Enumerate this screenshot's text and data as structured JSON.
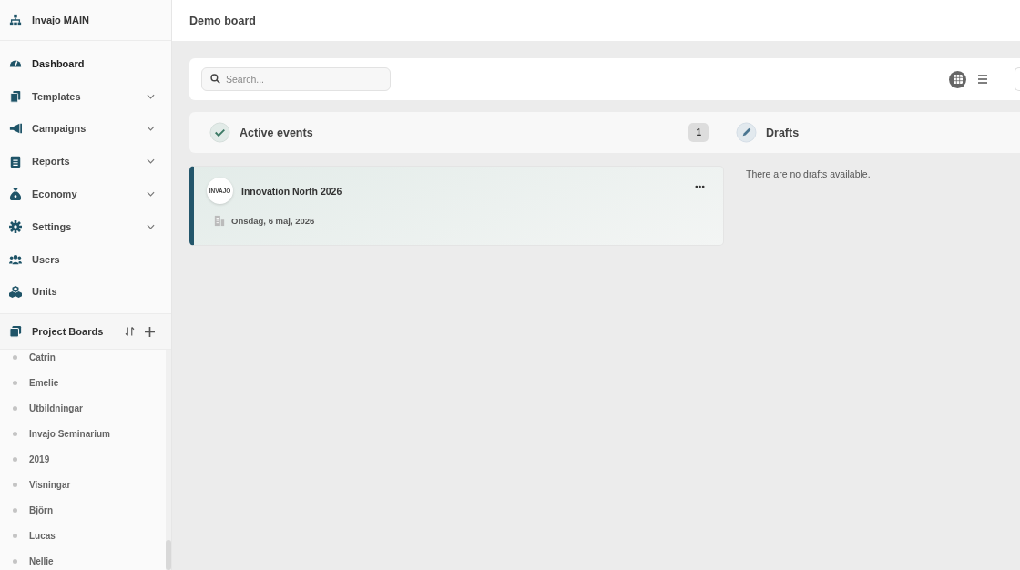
{
  "sidebar": {
    "brand": "Invajo MAIN",
    "nav": [
      {
        "label": "Dashboard",
        "expandable": false
      },
      {
        "label": "Templates",
        "expandable": true
      },
      {
        "label": "Campaigns",
        "expandable": true
      },
      {
        "label": "Reports",
        "expandable": true
      },
      {
        "label": "Economy",
        "expandable": true
      },
      {
        "label": "Settings",
        "expandable": true
      },
      {
        "label": "Users",
        "expandable": false
      },
      {
        "label": "Units",
        "expandable": false
      }
    ],
    "project_boards": {
      "title": "Project Boards",
      "items": [
        "Catrin",
        "Emelie",
        "Utbildningar",
        "Invajo Seminarium",
        "2019",
        "Visningar",
        "Björn",
        "Lucas",
        "Nellie"
      ]
    }
  },
  "header": {
    "title": "Demo board"
  },
  "toolbar": {
    "search": {
      "placeholder": "Search..."
    },
    "views": [
      {
        "kind": "grid",
        "selected": true
      },
      {
        "kind": "list",
        "selected": false
      }
    ]
  },
  "columns": [
    {
      "kind": "active",
      "title": "Active events",
      "count": "1",
      "cards": [
        {
          "logo": "INVAJO",
          "title": "Innovation North 2026",
          "date": "Onsdag, 6 maj, 2026"
        }
      ]
    },
    {
      "kind": "drafts",
      "title": "Drafts",
      "empty": "There are no drafts available."
    }
  ]
}
